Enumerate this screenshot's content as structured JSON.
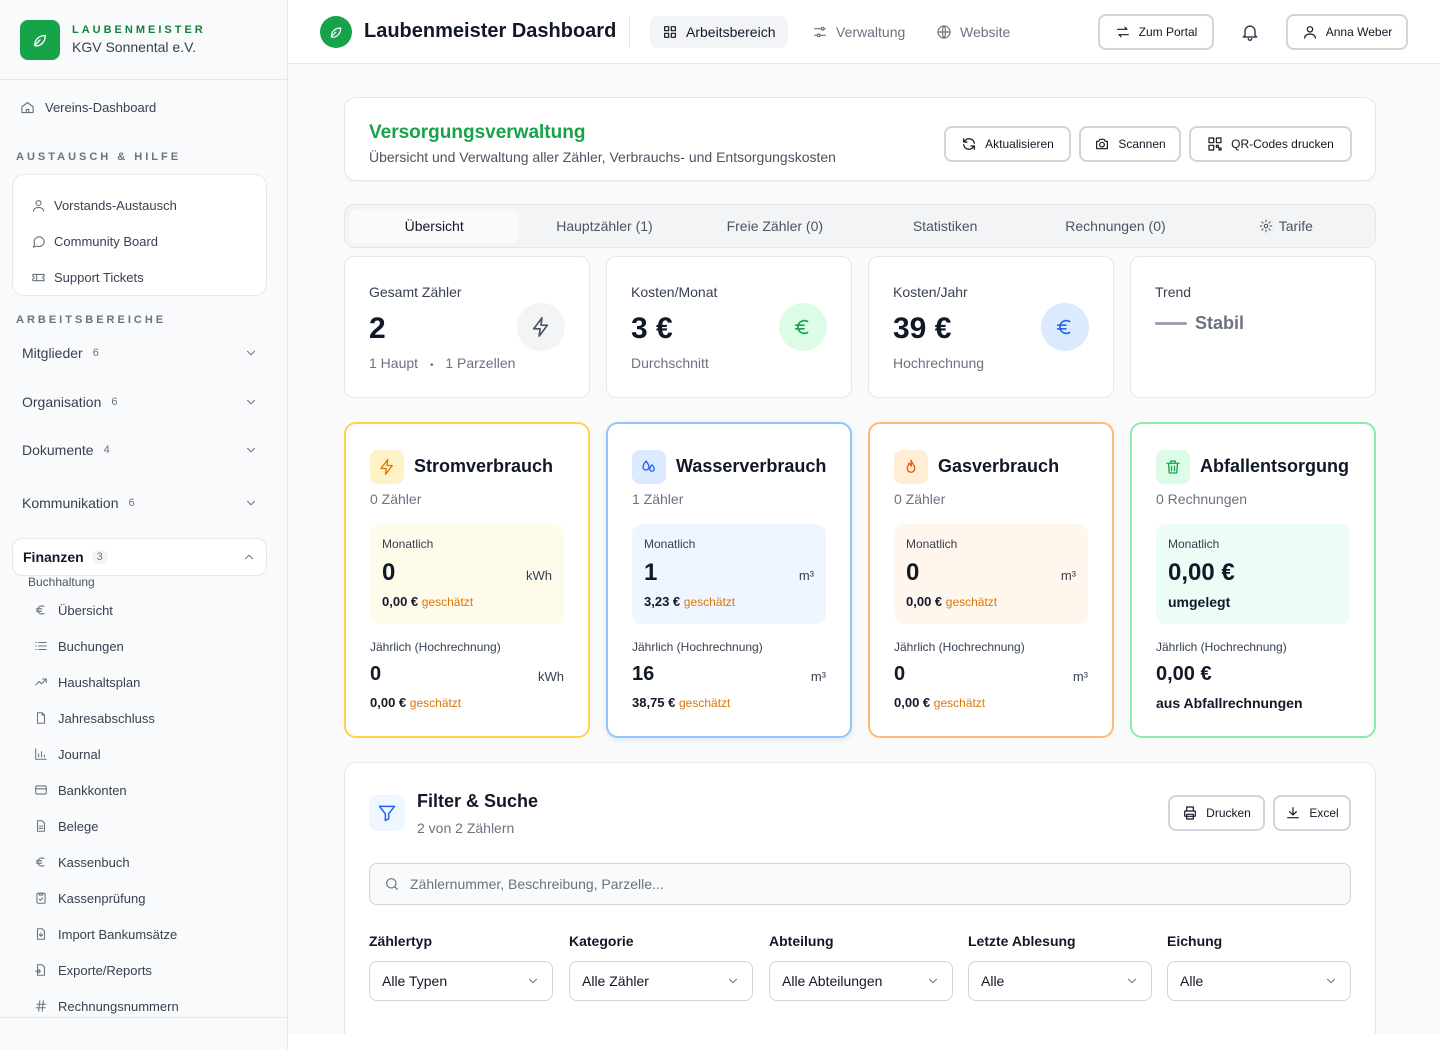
{
  "brand": {
    "title": "LAUBENMEISTER",
    "subtitle": "KGV Sonnental e.V."
  },
  "sidebar": {
    "dashboard": "Vereins-Dashboard",
    "help_section": "AUSTAUSCH & HILFE",
    "help_items": [
      {
        "label": "Vorstands-Austausch",
        "icon": "users-icon"
      },
      {
        "label": "Community Board",
        "icon": "chat-icon"
      },
      {
        "label": "Support Tickets",
        "icon": "ticket-icon"
      }
    ],
    "areas_section": "ARBEITSBEREICHE",
    "groups": [
      {
        "label": "Mitglieder",
        "count": "6"
      },
      {
        "label": "Organisation",
        "count": "6"
      },
      {
        "label": "Dokumente",
        "count": "4"
      },
      {
        "label": "Kommunikation",
        "count": "6"
      }
    ],
    "open_group": {
      "label": "Finanzen",
      "count": "3"
    },
    "sub_label": "Buchhaltung",
    "sub_items": [
      {
        "label": "Übersicht",
        "icon": "euro-icon"
      },
      {
        "label": "Buchungen",
        "icon": "list-icon"
      },
      {
        "label": "Haushaltsplan",
        "icon": "trend-icon"
      },
      {
        "label": "Jahresabschluss",
        "icon": "file-icon"
      },
      {
        "label": "Journal",
        "icon": "chart-icon"
      },
      {
        "label": "Bankkonten",
        "icon": "card-icon"
      },
      {
        "label": "Belege",
        "icon": "document-icon"
      },
      {
        "label": "Kassenbuch",
        "icon": "euro-icon"
      },
      {
        "label": "Kassenprüfung",
        "icon": "clipboard-icon"
      },
      {
        "label": "Import Bankumsätze",
        "icon": "file-import-icon"
      },
      {
        "label": "Exporte/Reports",
        "icon": "file-export-icon"
      },
      {
        "label": "Rechnungsnummern",
        "icon": "hash-icon"
      }
    ]
  },
  "topbar": {
    "title": "Laubenmeister Dashboard",
    "nav": [
      {
        "label": "Arbeitsbereich",
        "active": true
      },
      {
        "label": "Verwaltung",
        "active": false
      },
      {
        "label": "Website",
        "active": false
      }
    ],
    "portal_button": "Zum Portal",
    "user_name": "Anna Weber"
  },
  "page": {
    "title": "Versorgungsverwaltung",
    "subtitle": "Übersicht und Verwaltung aller Zähler, Verbrauchs- und Entsorgungskosten",
    "actions": {
      "refresh": "Aktualisieren",
      "scan": "Scannen",
      "qr": "QR-Codes drucken"
    },
    "tabs": [
      "Übersicht",
      "Hauptzähler (1)",
      "Freie Zähler (0)",
      "Statistiken",
      "Rechnungen (0)",
      "Tarife"
    ],
    "active_tab": "Übersicht"
  },
  "stats": [
    {
      "label": "Gesamt Zähler",
      "value": "2",
      "note_a": "1 Haupt",
      "note_sep": "•",
      "note_b": "1 Parzellen"
    },
    {
      "label": "Kosten/Monat",
      "value": "3 €",
      "note": "Durchschnitt"
    },
    {
      "label": "Kosten/Jahr",
      "value": "39 €",
      "note": "Hochrechnung"
    },
    {
      "label": "Trend",
      "value": "Stabil"
    }
  ],
  "utilities": [
    {
      "title": "Stromverbrauch",
      "sub": "0 Zähler",
      "monthly_label": "Monatlich",
      "monthly_value": "0",
      "unit": "kWh",
      "monthly_cost": "0,00 €",
      "estimated": "geschätzt",
      "yearly_label": "Jährlich (Hochrechnung)",
      "yearly_value": "0",
      "yearly_cost": "0,00 €",
      "color": "#fcd34d",
      "icon": "bolt-icon"
    },
    {
      "title": "Wasserverbrauch",
      "sub": "1 Zähler",
      "monthly_label": "Monatlich",
      "monthly_value": "1",
      "unit": "m³",
      "monthly_cost": "3,23 €",
      "estimated": "geschätzt",
      "yearly_label": "Jährlich (Hochrechnung)",
      "yearly_value": "16",
      "yearly_cost": "38,75 €",
      "color": "#93c5fd",
      "icon": "droplets-icon"
    },
    {
      "title": "Gasverbrauch",
      "sub": "0 Zähler",
      "monthly_label": "Monatlich",
      "monthly_value": "0",
      "unit": "m³",
      "monthly_cost": "0,00 €",
      "estimated": "geschätzt",
      "yearly_label": "Jährlich (Hochrechnung)",
      "yearly_value": "0",
      "yearly_cost": "0,00 €",
      "color": "#fdba74",
      "icon": "flame-icon"
    },
    {
      "title": "Abfallentsorgung",
      "sub": "0 Rechnungen",
      "monthly_label": "Monatlich",
      "monthly_value": "0,00 €",
      "monthly_cost": "umgelegt",
      "yearly_label": "Jährlich (Hochrechnung)",
      "yearly_value": "0,00 €",
      "yearly_cost": "aus Abfallrechnungen",
      "color": "#86efac",
      "icon": "trash-icon"
    }
  ],
  "filter": {
    "title": "Filter & Suche",
    "sub": "2 von 2 Zählern",
    "print": "Drucken",
    "excel": "Excel",
    "search_placeholder": "Zählernummer, Beschreibung, Parzelle...",
    "fields": [
      {
        "label": "Zählertyp",
        "value": "Alle Typen"
      },
      {
        "label": "Kategorie",
        "value": "Alle Zähler"
      },
      {
        "label": "Abteilung",
        "value": "Alle Abteilungen"
      },
      {
        "label": "Letzte Ablesung",
        "value": "Alle"
      },
      {
        "label": "Eichung",
        "value": "Alle"
      }
    ]
  }
}
